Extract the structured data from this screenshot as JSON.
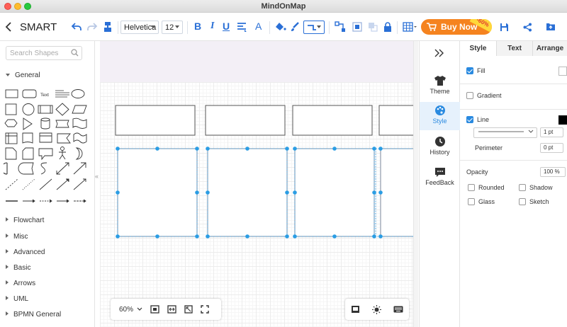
{
  "window": {
    "title": "MindOnMap"
  },
  "toolbar": {
    "doc_title": "SMART",
    "font_family": "Helvetica",
    "font_size": "12",
    "bold": "B",
    "italic": "I",
    "underline": "U",
    "text_color": "A",
    "buy_label": "Buy Now",
    "buy_discount": "-60%",
    "accent_color": "#2a6fd6"
  },
  "left_panel": {
    "search_placeholder": "Search Shapes",
    "text_shape_label": "Text",
    "open_category": "General",
    "categories": [
      "Flowchart",
      "Misc",
      "Advanced",
      "Basic",
      "Arrows",
      "UML",
      "BPMN General"
    ]
  },
  "zoom": {
    "level": "60%"
  },
  "rail": {
    "items": [
      {
        "label": "Theme",
        "icon": "shirt-icon"
      },
      {
        "label": "Style",
        "icon": "palette-icon",
        "active": true
      },
      {
        "label": "History",
        "icon": "clock-icon"
      },
      {
        "label": "FeedBack",
        "icon": "feedback-icon"
      }
    ]
  },
  "props": {
    "tabs": [
      "Style",
      "Text",
      "Arrange"
    ],
    "active_tab": "Style",
    "fill": {
      "label": "Fill",
      "checked": true
    },
    "gradient": {
      "label": "Gradient",
      "checked": false
    },
    "line": {
      "label": "Line",
      "checked": true,
      "color": "#000000",
      "width": "1 pt"
    },
    "perimeter": {
      "label": "Perimeter",
      "value": "0 pt"
    },
    "opacity": {
      "label": "Opacity",
      "value": "100 %"
    },
    "rounded": {
      "label": "Rounded",
      "checked": false
    },
    "shadow": {
      "label": "Shadow",
      "checked": false
    },
    "glass": {
      "label": "Glass",
      "checked": false
    },
    "sketch": {
      "label": "Sketch",
      "checked": false
    }
  }
}
